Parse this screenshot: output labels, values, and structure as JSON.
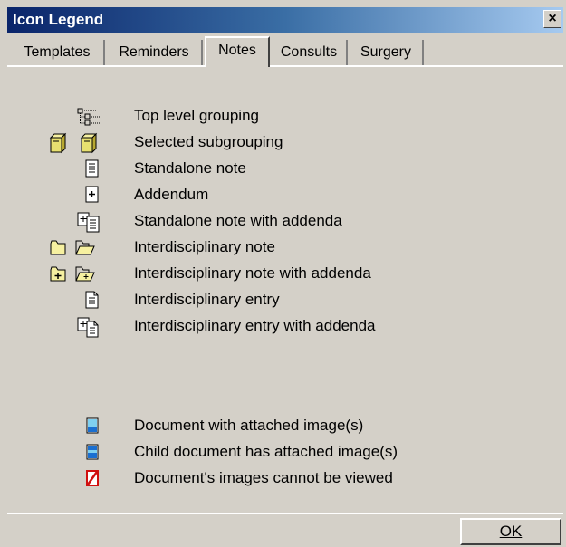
{
  "window": {
    "title": "Icon Legend",
    "close_label": "×"
  },
  "tabs": [
    {
      "label": "Templates",
      "active": false
    },
    {
      "label": "Reminders",
      "active": false
    },
    {
      "label": "Notes",
      "active": true
    },
    {
      "label": "Consults",
      "active": false
    },
    {
      "label": "Surgery",
      "active": false
    }
  ],
  "legend": [
    {
      "icon": "tree-grouping-icon",
      "label": "Top level grouping"
    },
    {
      "icon": "books-icon",
      "label": "Selected subgrouping"
    },
    {
      "icon": "note-icon",
      "label": "Standalone note"
    },
    {
      "icon": "addendum-icon",
      "label": "Addendum"
    },
    {
      "icon": "note-with-addenda-icon",
      "label": "Standalone note with addenda"
    },
    {
      "icon": "folder-icon",
      "label": "Interdisciplinary note"
    },
    {
      "icon": "folder-plus-icon",
      "label": "Interdisciplinary note with addenda"
    },
    {
      "icon": "entry-icon",
      "label": "Interdisciplinary entry"
    },
    {
      "icon": "entry-with-addenda-icon",
      "label": "Interdisciplinary entry with addenda"
    }
  ],
  "image_legend": [
    {
      "icon": "attached-image-icon",
      "label": "Document with attached image(s)"
    },
    {
      "icon": "child-image-icon",
      "label": "Child document has attached image(s)"
    },
    {
      "icon": "image-blocked-icon",
      "label": "Document's images cannot be viewed"
    }
  ],
  "buttons": {
    "ok_label": "OK"
  },
  "colors": {
    "title_bar": "#0a246a",
    "dialog_bg": "#d4d0c8",
    "folder_yellow": "#e8e070",
    "image_blue": "#1a6fd0",
    "blocked_red": "#d01010"
  }
}
